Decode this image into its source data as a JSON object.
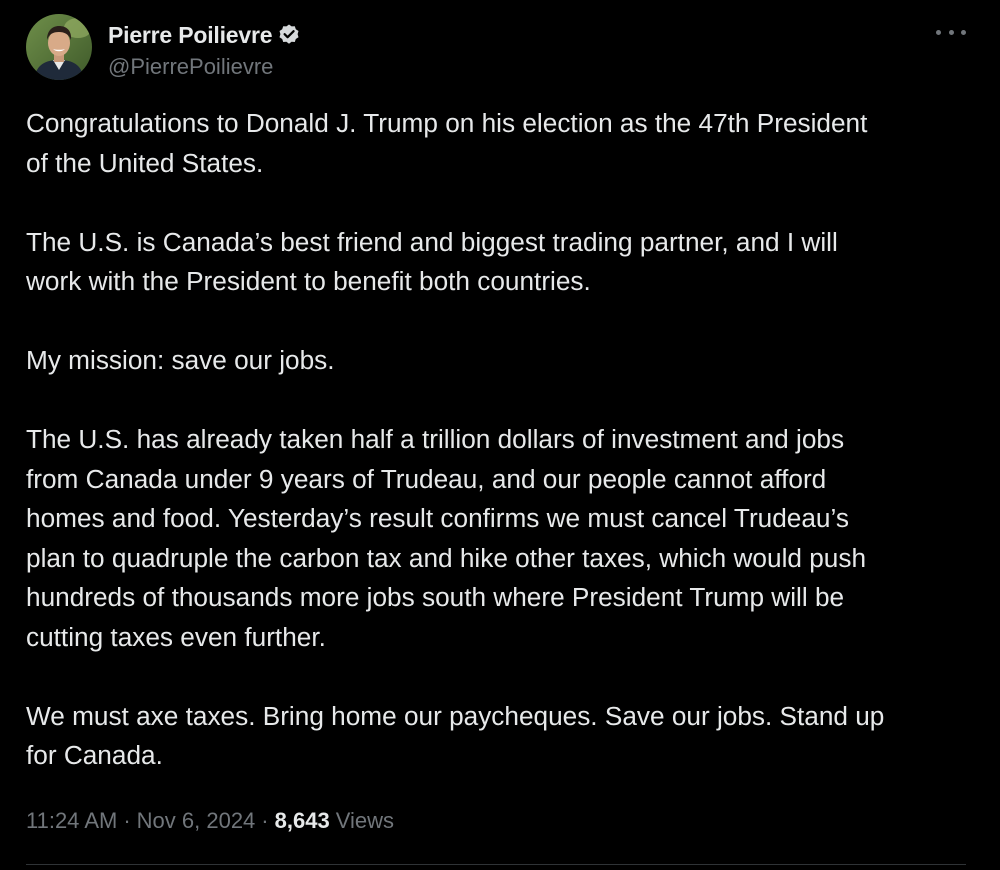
{
  "author": {
    "display_name": "Pierre Poilievre",
    "handle": "@PierrePoilievre",
    "verified_icon": "verified-badge-icon",
    "verified_color": "#1d9bf0"
  },
  "more_icon": "more-options-icon",
  "tweet": {
    "paragraphs": [
      "Congratulations to Donald J. Trump on his election as the 47th President\nof the United States.",
      "The U.S. is Canada’s best friend and biggest trading partner, and I will\nwork with the President to benefit both countries.",
      "My mission: save our jobs.",
      "The U.S. has already taken half a trillion dollars of investment and jobs\nfrom Canada under 9 years of Trudeau, and our people cannot afford\nhomes and food. Yesterday’s result confirms we must cancel Trudeau’s\nplan to quadruple the carbon tax and hike other taxes, which would push\nhundreds of thousands more jobs south where President Trump will be\ncutting taxes even further.",
      "We must axe taxes. Bring home our paycheques. Save our jobs. Stand up\nfor Canada."
    ]
  },
  "meta": {
    "time": "11:24 AM",
    "separator": "·",
    "date": "Nov 6, 2024",
    "views_count": "8,643",
    "views_label": "Views"
  },
  "colors": {
    "background": "#000000",
    "text_primary": "#e7e9ea",
    "text_secondary": "#71767b",
    "divider": "#2f3336"
  }
}
